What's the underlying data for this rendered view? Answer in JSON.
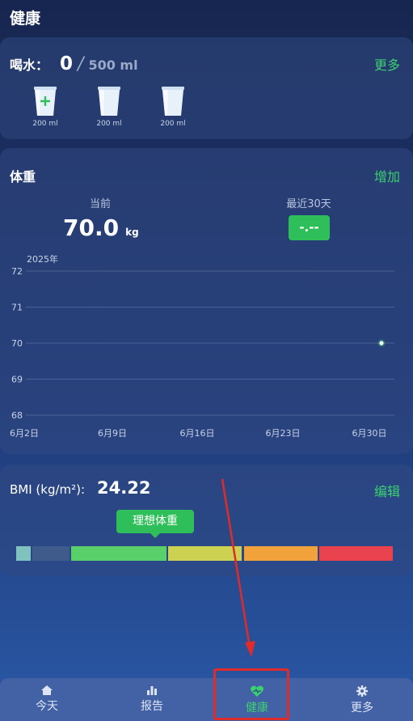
{
  "header": {
    "title": "健康"
  },
  "water": {
    "label": "喝水：",
    "current": "0",
    "separator": "/",
    "goal": "500 ml",
    "more_link": "更多",
    "cups": [
      {
        "label": "200 ml",
        "state": "add"
      },
      {
        "label": "200 ml",
        "state": "empty"
      },
      {
        "label": "200 ml",
        "state": "empty"
      }
    ]
  },
  "weight": {
    "title": "体重",
    "add_link": "增加",
    "current_label": "当前",
    "current_value": "70.0",
    "current_unit": "kg",
    "recent_label": "最近30天",
    "recent_value": "-.--"
  },
  "chart_data": {
    "type": "line",
    "year_label": "2025年",
    "x_tick_labels": [
      "6月2日",
      "6月9日",
      "6月16日",
      "6月23日",
      "6月30日"
    ],
    "y_ticks": [
      72,
      71,
      70,
      69,
      68
    ],
    "ylim": [
      68,
      72
    ],
    "grid": true,
    "series": [
      {
        "points": [
          {
            "x": "6月30日",
            "y": 70
          }
        ]
      }
    ]
  },
  "bmi": {
    "label": "BMI (kg/m²):",
    "value": "24.22",
    "edit_link": "编辑",
    "ideal_label": "理想体重",
    "segment_colors": [
      "#7fc2bf",
      "#3f5b8c",
      "#59d06a",
      "#cdd152",
      "#f2a23b",
      "#e8424e"
    ]
  },
  "nav": {
    "items": [
      {
        "label": "今天",
        "icon": "home-icon",
        "active": false
      },
      {
        "label": "报告",
        "icon": "bar-chart-icon",
        "active": false
      },
      {
        "label": "健康",
        "icon": "heart-icon",
        "active": true
      },
      {
        "label": "更多",
        "icon": "gear-icon",
        "active": false
      }
    ]
  },
  "colors": {
    "accent_green": "#3cd070",
    "badge_green": "#2fbf5a",
    "annotation_red": "#e02b2b"
  }
}
